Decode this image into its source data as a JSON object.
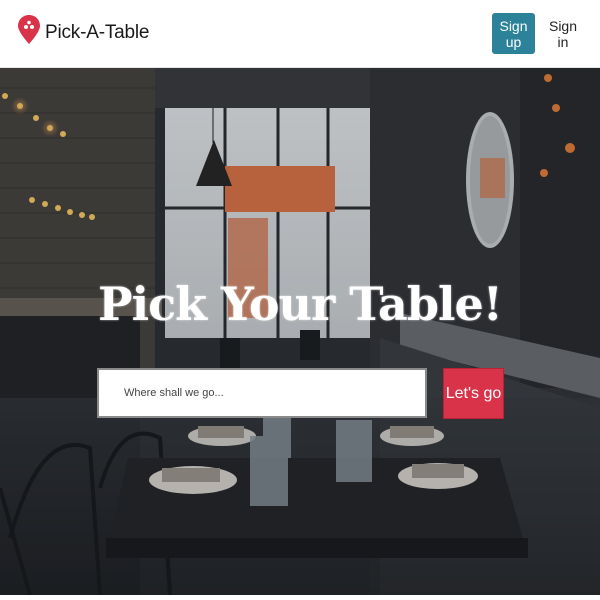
{
  "header": {
    "brand": "Pick-A-Table",
    "signup_label": "Sign up",
    "signin_label": "Sign in"
  },
  "hero": {
    "title": "Pick Your Table!",
    "search": {
      "placeholder": "Where shall we go..."
    },
    "button_label": "Let's go"
  },
  "colors": {
    "brand_red": "#d9334a",
    "signup_teal": "#2b8299"
  },
  "icons": [
    "map-pin-icon"
  ]
}
